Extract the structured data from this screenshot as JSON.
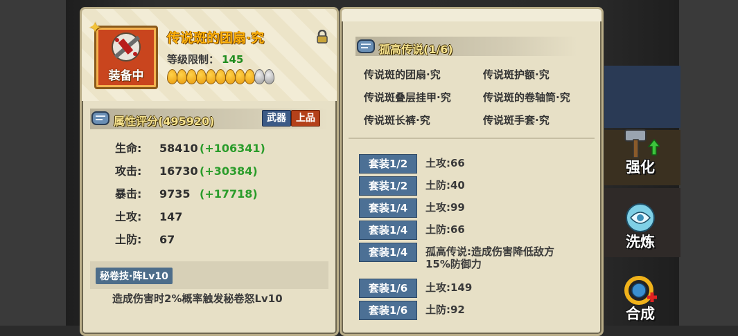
{
  "item": {
    "name": "传说斑的团扇·究",
    "level_label": "等级限制：",
    "level_value": "145",
    "equipped_label": "装备中",
    "star_level": 9,
    "star_max": 11,
    "locked": true
  },
  "attributes": {
    "title": "属性评分(495920)",
    "tag_type": "武器",
    "tag_grade": "上品",
    "rows": [
      {
        "label": "生命:",
        "value": "58410",
        "bonus": "(+106341)"
      },
      {
        "label": "攻击:",
        "value": "16730",
        "bonus": "(+30384)"
      },
      {
        "label": "暴击:",
        "value": "9735",
        "bonus": "(+17718)"
      },
      {
        "label": "土攻:",
        "value": "147",
        "bonus": ""
      },
      {
        "label": "土防:",
        "value": "67",
        "bonus": ""
      }
    ]
  },
  "skill": {
    "title": "秘卷技·阵Lv10",
    "desc": "造成伤害时2%概率触发秘卷怒Lv10"
  },
  "set": {
    "title": "孤高传说(1/6)",
    "members": [
      "传说斑的团扇·究",
      "传说斑护额·究",
      "传说斑叠层挂甲·究",
      "传说斑的卷轴筒·究",
      "传说斑长裤·究",
      "传说斑手套·究"
    ],
    "bonuses": [
      {
        "tag": "套装1/2",
        "text": "土攻:66"
      },
      {
        "tag": "套装1/2",
        "text": "土防:40"
      },
      {
        "tag": "套装1/4",
        "text": "土攻:99"
      },
      {
        "tag": "套装1/4",
        "text": "土防:66"
      },
      {
        "tag": "套装1/4",
        "text": "孤高传说:造成伤害降低敌方",
        "text2": "15%防御力"
      },
      {
        "tag": "套装1/6",
        "text": "土攻:149"
      },
      {
        "tag": "套装1/6",
        "text": "土防:92"
      }
    ]
  },
  "side_buttons": {
    "enhance": "强化",
    "refine": "洗炼",
    "synthesize": "合成"
  },
  "colors": {
    "panel": "#e7e0c6",
    "name_gold": "#ffb10a",
    "bonus_green": "#2a9c2a",
    "tag_blue": "#4c7095"
  }
}
